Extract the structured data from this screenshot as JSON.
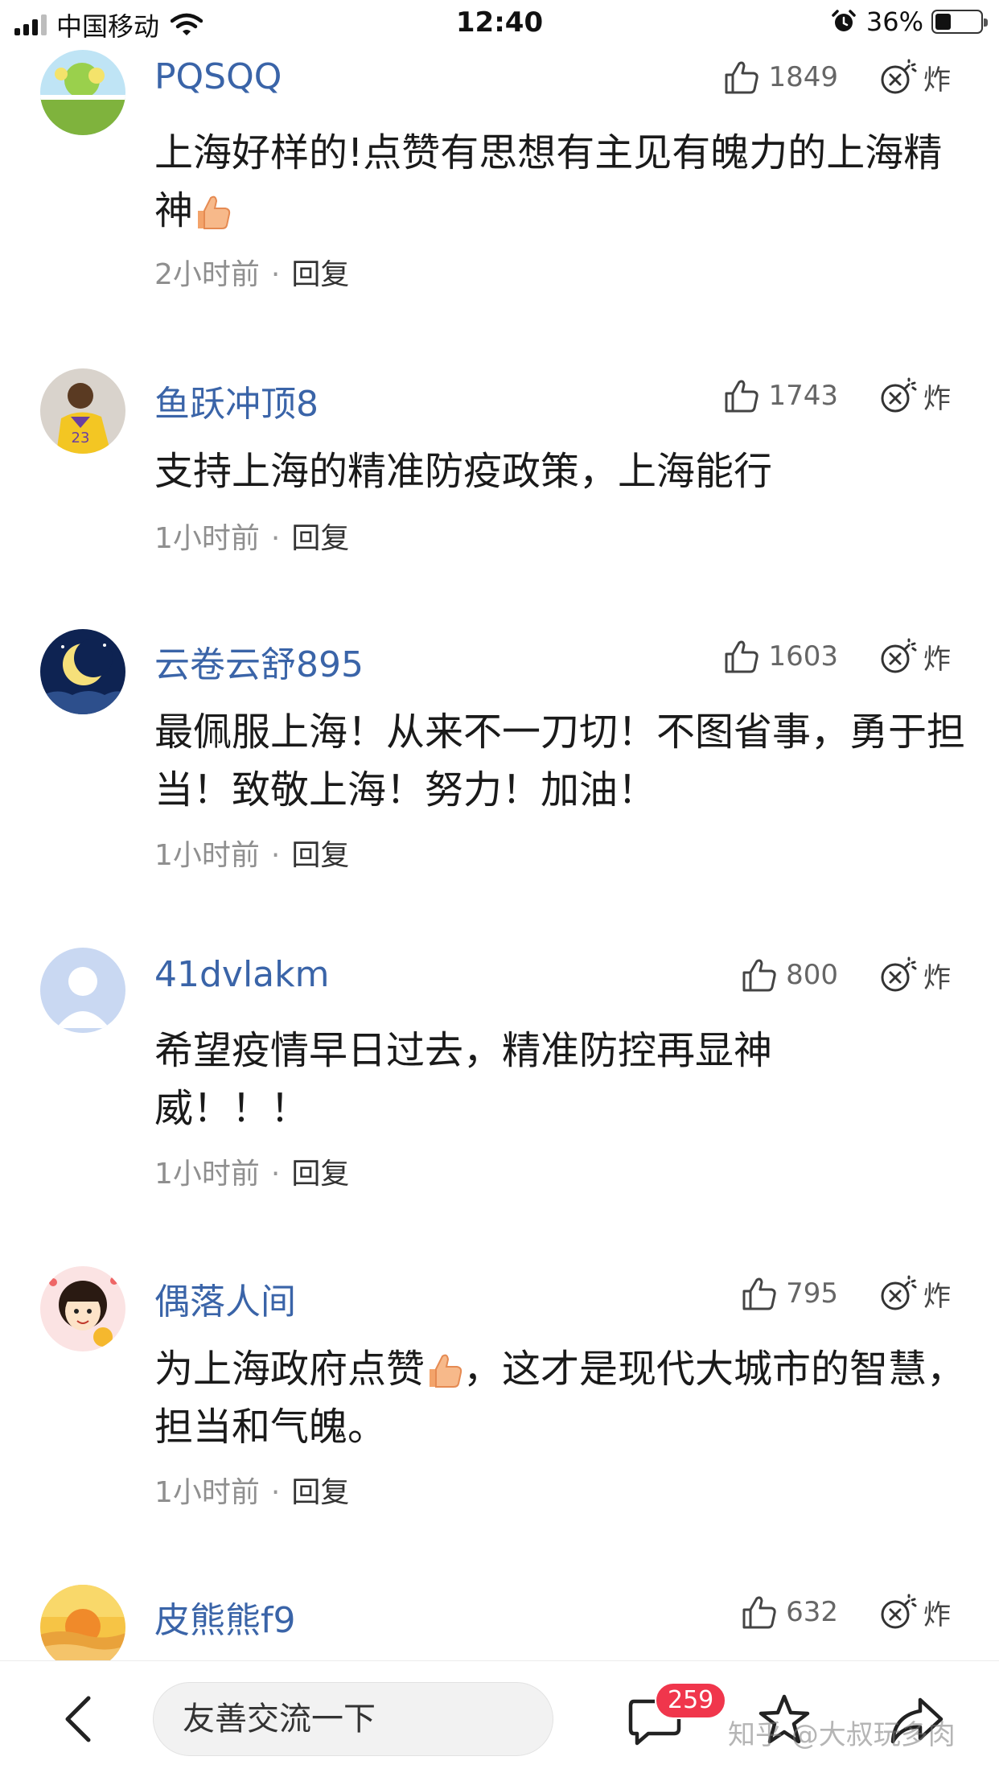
{
  "status_bar": {
    "carrier": "中国移动",
    "time": "12:40",
    "battery": "36%",
    "battery_level": 0.36
  },
  "comments": [
    {
      "username": "PQSQQ",
      "likes": "1849",
      "bomb_label": "炸",
      "text_parts": [
        "上海好样的!点赞有思想有主见有魄力的上海精神"
      ],
      "emoji_after": [
        0
      ],
      "time": "2小时前",
      "separator": "·",
      "reply": "回复",
      "avatar_icon": "landscape-avatar-icon"
    },
    {
      "username": "鱼跃冲顶8",
      "likes": "1743",
      "bomb_label": "炸",
      "text_parts": [
        "支持上海的精准防疫政策，上海能行"
      ],
      "emoji_after": [],
      "time": "1小时前",
      "separator": "·",
      "reply": "回复",
      "avatar_icon": "basketball-player-avatar-icon"
    },
    {
      "username": "云卷云舒895",
      "likes": "1603",
      "bomb_label": "炸",
      "text_parts": [
        "最佩服上海！从来不一刀切！不图省事，勇于担当！致敬上海！努力！加油！"
      ],
      "emoji_after": [],
      "time": "1小时前",
      "separator": "·",
      "reply": "回复",
      "avatar_icon": "moon-avatar-icon"
    },
    {
      "username": "41dvlakm",
      "likes": "800",
      "bomb_label": "炸",
      "text_parts": [
        "希望疫情早日过去，精准防控再显神威！！！"
      ],
      "emoji_after": [],
      "time": "1小时前",
      "separator": "·",
      "reply": "回复",
      "avatar_icon": "default-user-avatar-icon"
    },
    {
      "username": "偶落人间",
      "likes": "795",
      "bomb_label": "炸",
      "text_parts": [
        "为上海政府点赞",
        "，这才是现代大城市的智慧，担当和气魄。"
      ],
      "emoji_after": [
        0
      ],
      "time": "1小时前",
      "separator": "·",
      "reply": "回复",
      "avatar_icon": "cartoon-girl-avatar-icon"
    },
    {
      "username": "皮熊熊f9",
      "likes": "632",
      "bomb_label": "炸",
      "text_parts": [],
      "emoji_after": [],
      "time": "",
      "separator": "",
      "reply": "",
      "avatar_icon": "sunset-avatar-icon"
    }
  ],
  "bottom_bar": {
    "input_placeholder": "友善交流一下",
    "comment_count": "259",
    "watermark": "知乎 @大叔玩多肉"
  },
  "colors": {
    "username": "#3a64a8",
    "badge": "#f0364c",
    "meta": "#8f8f8f"
  }
}
